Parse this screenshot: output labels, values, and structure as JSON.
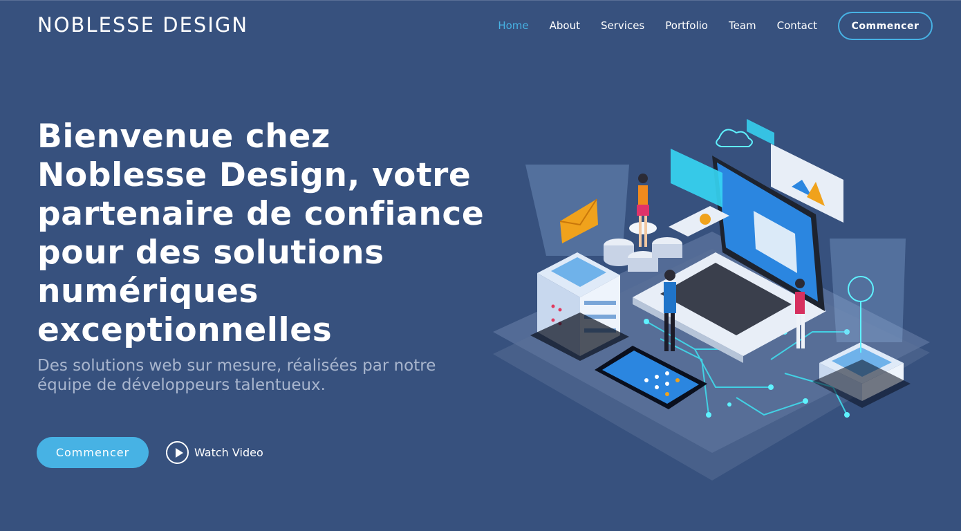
{
  "header": {
    "logo": "NOBLESSE DESIGN",
    "nav": [
      {
        "label": "Home",
        "active": true
      },
      {
        "label": "About",
        "active": false
      },
      {
        "label": "Services",
        "active": false
      },
      {
        "label": "Portfolio",
        "active": false
      },
      {
        "label": "Team",
        "active": false
      },
      {
        "label": "Contact",
        "active": false
      }
    ],
    "cta_label": "Commencer"
  },
  "hero": {
    "title": "Bienvenue chez Noblesse Design, votre partenaire de confiance pour des solutions numériques exceptionnelles",
    "subtitle": "Des solutions web sur mesure, réalisées par notre équipe de développeurs talentueux.",
    "primary_button": "Commencer",
    "video_button": "Watch Video"
  },
  "icons": [
    "play-icon"
  ],
  "colors": {
    "background": "#37517e",
    "accent": "#47b2e4",
    "subtitle": "#a9b6ce"
  }
}
